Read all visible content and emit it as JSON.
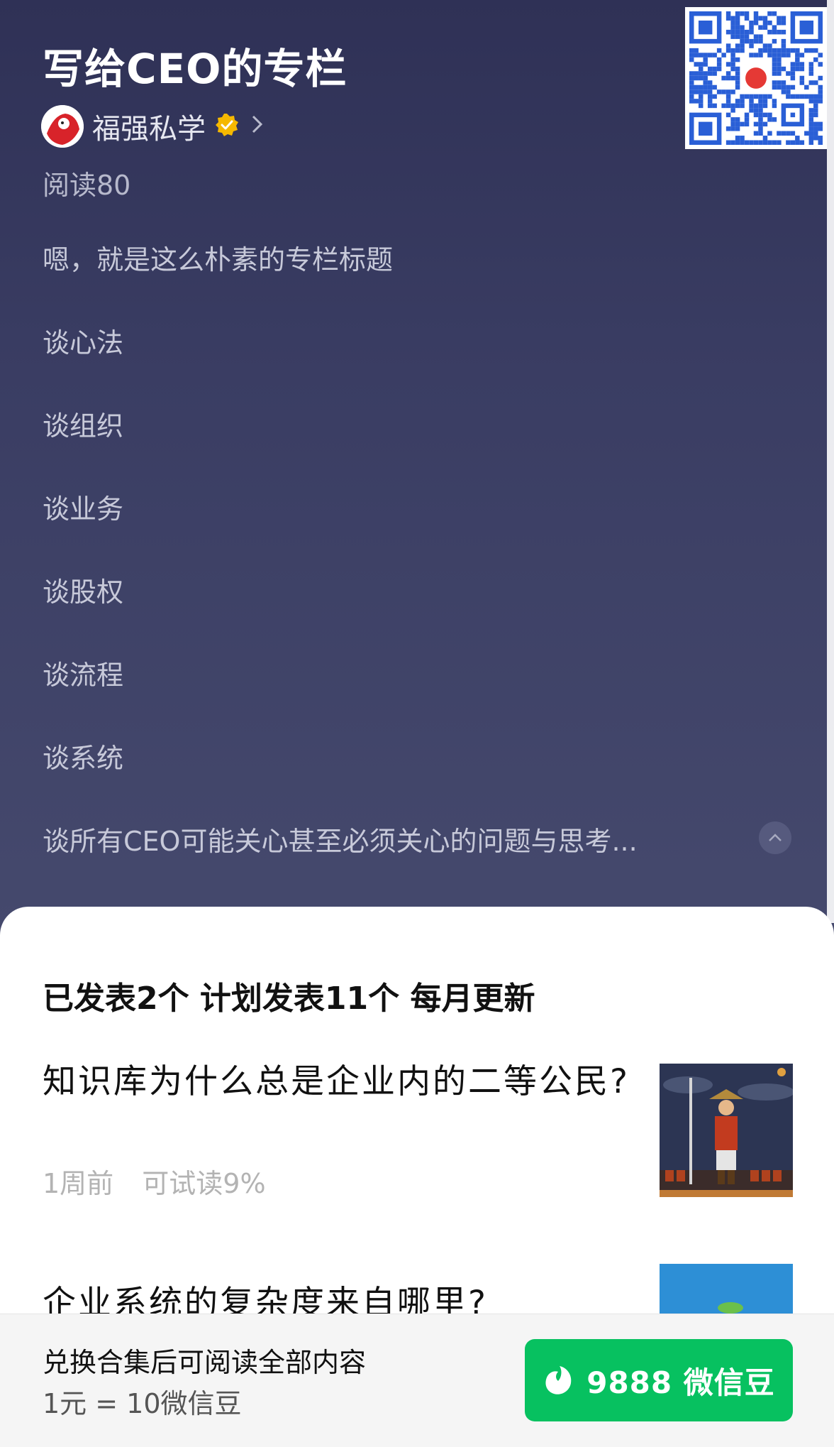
{
  "column": {
    "title": "写给CEO的专栏",
    "author": "福强私学",
    "reads": "阅读80",
    "description_lines": [
      "嗯，就是这么朴素的专栏标题",
      "谈心法",
      "谈组织",
      "谈业务",
      "谈股权",
      "谈流程",
      "谈系统",
      "谈所有CEO可能关心甚至必须关心的问题与思考..."
    ]
  },
  "sheet": {
    "stats": "已发表2个 计划发表11个 每月更新",
    "articles": [
      {
        "title": "知识库为什么总是企业内的二等公民?",
        "time": "1周前",
        "trial": "可试读9%"
      },
      {
        "title": "企业系统的复杂度来自哪里?"
      }
    ]
  },
  "bottom_bar": {
    "line1": "兑换合集后可阅读全部内容",
    "line2": "1元 = 10微信豆",
    "button_label": "9888 微信豆"
  },
  "colors": {
    "header_bg": "#3a3d63",
    "accent_green": "#07c160",
    "verified_badge": "#f5b800"
  },
  "icons": [
    "qr-code",
    "avatar",
    "verified-badge-icon",
    "chevron-right-icon",
    "chevron-up-icon",
    "wechat-bean-icon"
  ]
}
